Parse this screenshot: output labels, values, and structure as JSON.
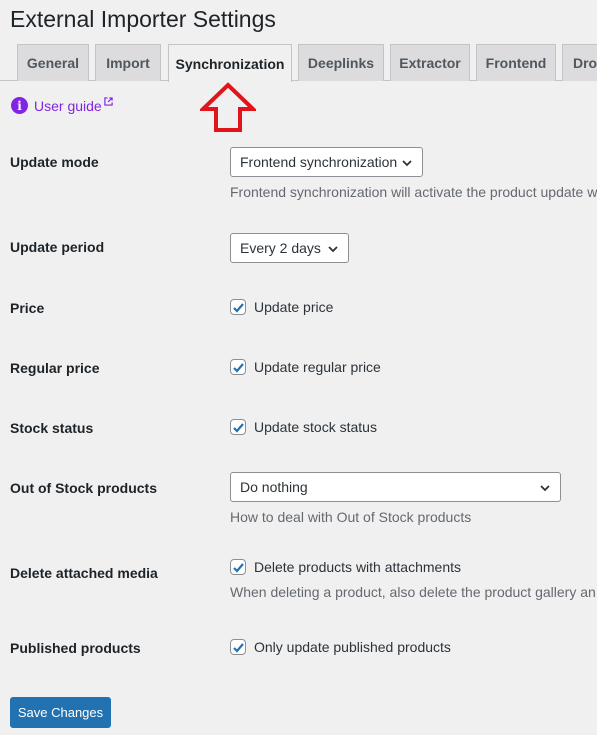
{
  "page": {
    "title": "External Importer Settings"
  },
  "tabs": [
    {
      "label": "General"
    },
    {
      "label": "Import"
    },
    {
      "label": "Synchronization",
      "active": true
    },
    {
      "label": "Deeplinks"
    },
    {
      "label": "Extractor"
    },
    {
      "label": "Frontend"
    },
    {
      "label": "Dro"
    }
  ],
  "guide": {
    "label": "User guide",
    "icon": "info-icon"
  },
  "settings": {
    "update_mode": {
      "label": "Update mode",
      "value": "Frontend synchronization",
      "description": "Frontend synchronization will activate the product update w"
    },
    "update_period": {
      "label": "Update period",
      "value": "Every 2 days"
    },
    "price": {
      "label": "Price",
      "checkbox_label": "Update price",
      "checked": true
    },
    "regular_price": {
      "label": "Regular price",
      "checkbox_label": "Update regular price",
      "checked": true
    },
    "stock_status": {
      "label": "Stock status",
      "checkbox_label": "Update stock status",
      "checked": true
    },
    "out_of_stock": {
      "label": "Out of Stock products",
      "value": "Do nothing",
      "description": "How to deal with Out of Stock products"
    },
    "delete_media": {
      "label": "Delete attached media",
      "checkbox_label": "Delete products with attachments",
      "checked": true,
      "description": "When deleting a product, also delete the product gallery an"
    },
    "published": {
      "label": "Published products",
      "checkbox_label": "Only update published products",
      "checked": true
    }
  },
  "actions": {
    "save_label": "Save Changes"
  },
  "colors": {
    "accent": "#2271b1",
    "guide_link": "#8224e3",
    "arrow": "#e0151b",
    "background": "#f0f0f1"
  }
}
